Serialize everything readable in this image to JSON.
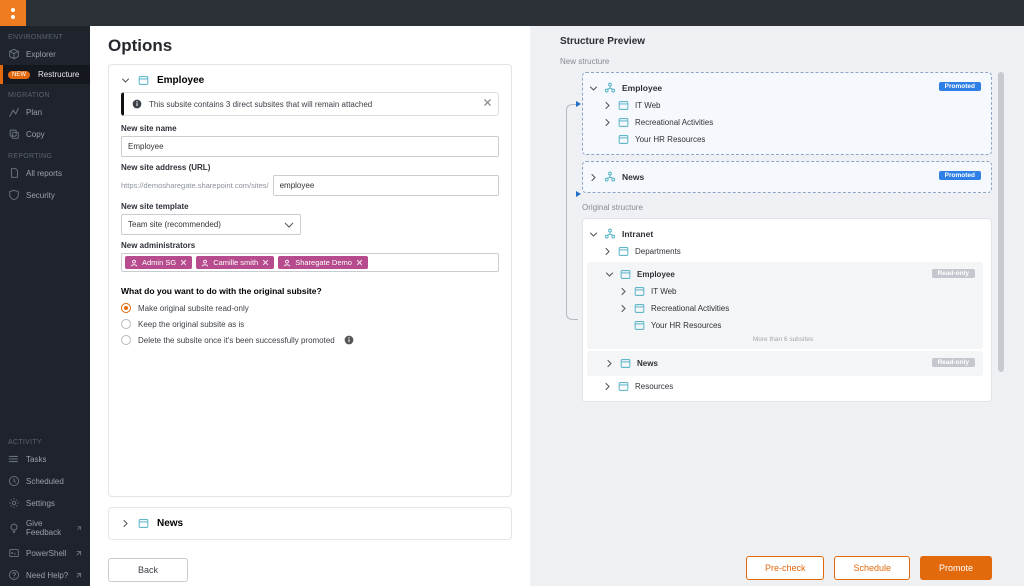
{
  "sidebar": {
    "sections": {
      "environment": "ENVIRONMENT",
      "migration": "MIGRATION",
      "reporting": "REPORTING",
      "activity": "ACTIVITY"
    },
    "items": {
      "explorer": "Explorer",
      "restructure_new": "NEW",
      "restructure": "Restructure",
      "plan": "Plan",
      "copy": "Copy",
      "all_reports": "All reports",
      "security": "Security",
      "tasks": "Tasks",
      "scheduled": "Scheduled",
      "settings": "Settings",
      "give_feedback": "Give Feedback",
      "powershell": "PowerShell",
      "need_help": "Need Help?"
    }
  },
  "options": {
    "title": "Options",
    "accordion_employee": "Employee",
    "accordion_news": "News",
    "alert": "This subsite contains 3 direct subsites that will remain attached",
    "labels": {
      "new_site_name": "New site name",
      "new_site_address": "New site address (URL)",
      "addr_prefix": "https://demosharegate.sharepoint.com/sites/",
      "new_site_template": "New site template",
      "new_admins": "New administrators"
    },
    "values": {
      "site_name": "Employee",
      "site_address": "employee",
      "template": "Team site (recommended)"
    },
    "admins": [
      "Admin SG",
      "Camille smith",
      "Sharegate Demo"
    ],
    "question": "What do you want to do with the original subsite?",
    "radios": {
      "read_only": "Make original subsite read-only",
      "keep": "Keep the original subsite as is",
      "delete": "Delete the subsite once it's been successfully promoted"
    }
  },
  "preview": {
    "title": "Structure Preview",
    "new_heading": "New structure",
    "orig_heading": "Original structure",
    "badge_promoted": "Promoted",
    "badge_readonly": "Read-only",
    "nodes": {
      "employee": "Employee",
      "it_web": "IT Web",
      "rec": "Recreational Activities",
      "hr": "Your HR Resources",
      "news": "News",
      "intranet": "Intranet",
      "departments": "Departments",
      "resources": "Resources"
    },
    "more": "More than 6 subsites"
  },
  "footer": {
    "back": "Back",
    "precheck": "Pre-check",
    "schedule": "Schedule",
    "promote": "Promote"
  }
}
